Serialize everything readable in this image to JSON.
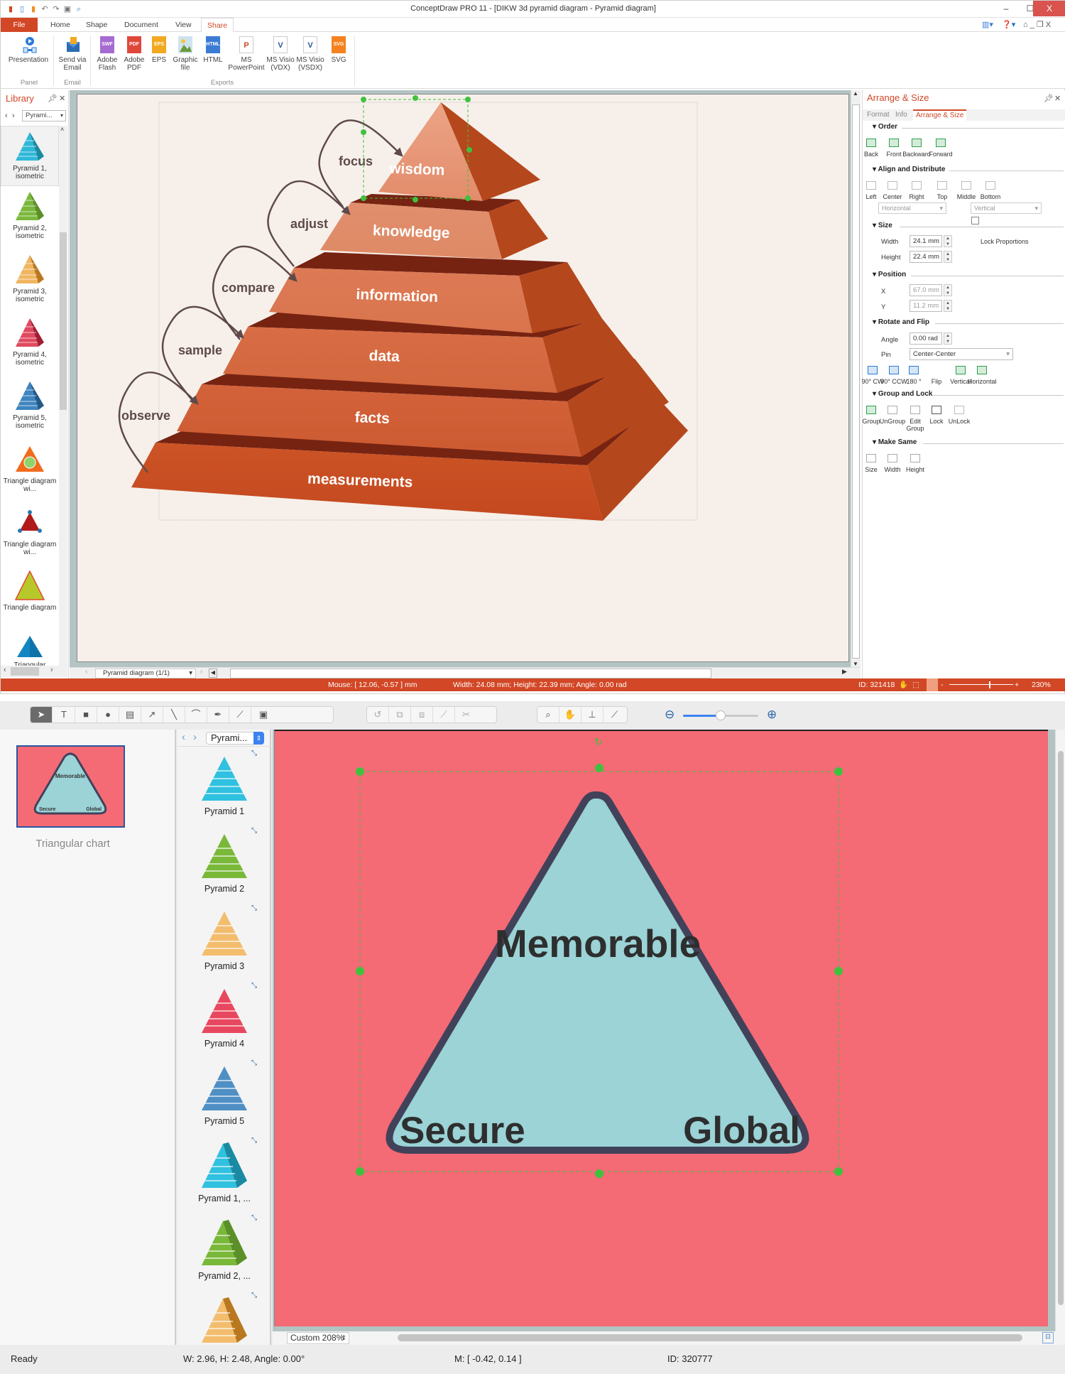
{
  "app": {
    "window_title": "ConceptDraw PRO 11 - [DIKW 3d pyramid diagram - Pyramid diagram]",
    "window_controls": {
      "minimize": "–",
      "maximize": "☐",
      "close": "X"
    }
  },
  "ribbon": {
    "tabs": [
      {
        "label": "File"
      },
      {
        "label": "Home"
      },
      {
        "label": "Shape"
      },
      {
        "label": "Document"
      },
      {
        "label": "View"
      },
      {
        "label": "Share",
        "active": true
      }
    ],
    "buttons": [
      {
        "label": "Presentation",
        "icon": "presentation-icon"
      },
      {
        "label": "Send via Email",
        "icon": "email-icon"
      },
      {
        "label": "Adobe Flash",
        "icon": "swf-file-icon",
        "badge": "SWF",
        "color": "#a66bd1"
      },
      {
        "label": "Adobe PDF",
        "icon": "pdf-file-icon",
        "badge": "PDF",
        "color": "#e0473b"
      },
      {
        "label": "EPS",
        "icon": "eps-file-icon",
        "badge": "EPS",
        "color": "#f2a81f"
      },
      {
        "label": "Graphic file",
        "icon": "image-file-icon",
        "badge": "",
        "color": "#8fb7d6"
      },
      {
        "label": "HTML",
        "icon": "html-file-icon",
        "badge": "HTML",
        "color": "#3b7bd4"
      },
      {
        "label": "MS PowerPoint",
        "icon": "powerpoint-icon",
        "badge": "P",
        "color": "#d24726"
      },
      {
        "label": "MS Visio (VDX)",
        "icon": "visio-vdx-icon",
        "badge": "V",
        "color": "#2b579a"
      },
      {
        "label": "MS Visio (VSDX)",
        "icon": "visio-vsdx-icon",
        "badge": "V",
        "color": "#2b579a"
      },
      {
        "label": "SVG",
        "icon": "svg-file-icon",
        "badge": "SVG",
        "color": "#f58220"
      }
    ],
    "groups": [
      "Panel",
      "Email",
      "Exports"
    ]
  },
  "library": {
    "title": "Library",
    "selector": "Pyrami...",
    "items": [
      {
        "label": "Pyramid 1, isometric",
        "color": "#2fb8d8",
        "side": "#1a8aa3"
      },
      {
        "label": "Pyramid 2, isometric",
        "color": "#7ab83a",
        "side": "#5b8f27"
      },
      {
        "label": "Pyramid 3, isometric",
        "color": "#f0b560",
        "side": "#b9781f"
      },
      {
        "label": "Pyramid 4, isometric",
        "color": "#e04a60",
        "side": "#a31d33"
      },
      {
        "label": "Pyramid 5, isometric",
        "color": "#3f85c0",
        "side": "#225a8a"
      },
      {
        "label": "Triangle diagram wi...",
        "color": "#f26b1d",
        "side": "#8dd46a"
      },
      {
        "label": "Triangle diagram wi...",
        "color": "#b01a1a",
        "side": "#2a7ab0"
      },
      {
        "label": "Triangle diagram",
        "color": "#b7c92a",
        "side": "#e24b2b"
      },
      {
        "label": "Triangular diagram",
        "color": "#1386c2",
        "side": "#0c5f8f"
      }
    ]
  },
  "diagram": {
    "levels": [
      {
        "label": "wisdom"
      },
      {
        "label": "knowledge"
      },
      {
        "label": "information"
      },
      {
        "label": "data"
      },
      {
        "label": "facts"
      },
      {
        "label": "measurements"
      }
    ],
    "loops": [
      "focus",
      "adjust",
      "compare",
      "sample",
      "observe"
    ],
    "page_tab": "Pyramid diagram (1/1)",
    "colors": {
      "front": "#d9683f",
      "side": "#b5471c",
      "top": "#772312",
      "arrow": "#5e4a4a",
      "page": "#f7f0ea"
    }
  },
  "arrange_panel": {
    "title": "Arrange & Size",
    "tabs": [
      "Format",
      "Info",
      "Arrange & Size"
    ],
    "sections": {
      "order": {
        "title": "Order",
        "buttons": [
          "Back",
          "Front",
          "Backward",
          "Forward"
        ]
      },
      "align": {
        "title": "Align and Distribute",
        "buttons": [
          "Left",
          "Center",
          "Right",
          "Top",
          "Middle",
          "Bottom"
        ],
        "horizontal": "Horizontal",
        "vertical": "Vertical"
      },
      "size": {
        "title": "Size",
        "width_label": "Width",
        "width": "24.1 mm",
        "height_label": "Height",
        "height": "22.4 mm",
        "lock": "Lock Proportions"
      },
      "position": {
        "title": "Position",
        "x_label": "X",
        "x": "67.0 mm",
        "y_label": "Y",
        "y": "11.2 mm"
      },
      "rotate": {
        "title": "Rotate and Flip",
        "angle_label": "Angle",
        "angle": "0.00 rad",
        "pin_label": "Pin",
        "pin": "Center-Center",
        "buttons": [
          "90° CW",
          "90° CCW",
          "180 °",
          "Flip",
          "Vertical",
          "Horizontal"
        ]
      },
      "group": {
        "title": "Group and Lock",
        "buttons": [
          "Group",
          "UnGroup",
          "Edit Group",
          "Lock",
          "UnLock"
        ]
      },
      "same": {
        "title": "Make Same",
        "buttons": [
          "Size",
          "Width",
          "Height"
        ]
      }
    }
  },
  "status1": {
    "mouse": "Mouse: [ 12.06, -0.57 ] mm",
    "size": "Width: 24.08 mm;  Height: 22.39 mm;  Angle: 0.00 rad",
    "id": "ID: 321418",
    "zoom": "230%",
    "zoom_level": 0.62
  },
  "mac": {
    "thumbnail_caption": "Triangular chart",
    "library_selector": "Pyrami...",
    "library_items": [
      {
        "label": "Pyramid 1",
        "color": "#2fc1df"
      },
      {
        "label": "Pyramid 2",
        "color": "#7ab83a"
      },
      {
        "label": "Pyramid 3",
        "color": "#f3bd6e"
      },
      {
        "label": "Pyramid 4",
        "color": "#e8485f"
      },
      {
        "label": "Pyramid 5",
        "color": "#4f8fc4"
      },
      {
        "label": "Pyramid 1, ...",
        "color": "#2fc1df",
        "side": "#1a8aa3"
      },
      {
        "label": "Pyramid 2, ...",
        "color": "#7ab83a",
        "side": "#5b8f27"
      },
      {
        "label": "",
        "color": "#f3bd6e",
        "side": "#b9781f"
      }
    ],
    "chart": {
      "top": "Memorable",
      "left": "Secure",
      "right": "Global",
      "fill": "#9bd3d7",
      "stroke": "#41425a",
      "background": "#f46a75"
    },
    "zoom_select": "Custom 208%",
    "zoom_slider": 0.5,
    "status": {
      "ready": "Ready",
      "size": "W: 2.96,  H: 2.48,  Angle: 0.00°",
      "mouse": "M: [ -0.42, 0.14 ]",
      "id": "ID: 320777"
    }
  }
}
